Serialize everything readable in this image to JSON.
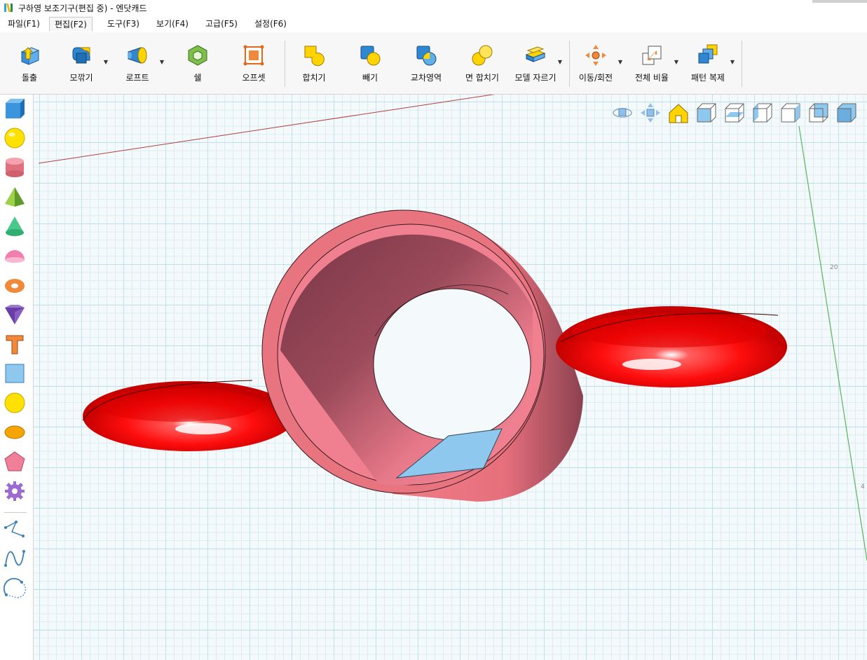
{
  "window": {
    "title": "구하영 보조기구(편집 중) - 엔닷캐드",
    "logo_icon": "ndotcad-logo-icon"
  },
  "menu": {
    "tabs": [
      {
        "label": "파일(F1)",
        "active": false
      },
      {
        "label": "편집(F2)",
        "active": true
      },
      {
        "label": "도구(F3)",
        "active": false
      },
      {
        "label": "보기(F4)",
        "active": false
      },
      {
        "label": "고급(F5)",
        "active": false
      },
      {
        "label": "설정(F6)",
        "active": false
      }
    ]
  },
  "ribbon": {
    "buttons": [
      {
        "label": "돌출",
        "icon": "extrude-icon",
        "has_dropdown": false
      },
      {
        "label": "모깎기",
        "icon": "fillet-icon",
        "has_dropdown": true
      },
      {
        "label": "로프트",
        "icon": "loft-icon",
        "has_dropdown": true
      },
      {
        "label": "쉘",
        "icon": "shell-icon",
        "has_dropdown": false
      },
      {
        "label": "오프셋",
        "icon": "offset-icon",
        "has_dropdown": false
      },
      {
        "label": "합치기",
        "icon": "union-icon",
        "has_dropdown": false
      },
      {
        "label": "빼기",
        "icon": "subtract-icon",
        "has_dropdown": false
      },
      {
        "label": "교차영역",
        "icon": "intersect-icon",
        "has_dropdown": false
      },
      {
        "label": "면 합치기",
        "icon": "face-merge-icon",
        "has_dropdown": false
      },
      {
        "label": "모델 자르기",
        "icon": "model-cut-icon",
        "has_dropdown": true
      },
      {
        "label": "이동/회전",
        "icon": "move-rotate-icon",
        "has_dropdown": true
      },
      {
        "label": "전체 비율",
        "icon": "scale-icon",
        "has_dropdown": true
      },
      {
        "label": "패턴 복제",
        "icon": "pattern-copy-icon",
        "has_dropdown": true
      }
    ]
  },
  "left_toolbar": {
    "tools": [
      {
        "name": "box-tool",
        "icon": "cube-icon"
      },
      {
        "name": "sphere-tool",
        "icon": "sphere-icon"
      },
      {
        "name": "cylinder-tool",
        "icon": "cylinder-icon"
      },
      {
        "name": "pyramid-tool",
        "icon": "pyramid-icon"
      },
      {
        "name": "cone-tool",
        "icon": "cone-icon"
      },
      {
        "name": "hemisphere-tool",
        "icon": "hemisphere-icon"
      },
      {
        "name": "torus-tool",
        "icon": "torus-icon"
      },
      {
        "name": "wedge-tool",
        "icon": "wedge-icon"
      },
      {
        "name": "text-tool",
        "icon": "text-t-icon"
      },
      {
        "name": "rectangle-tool",
        "icon": "rectangle-icon"
      },
      {
        "name": "circle-tool",
        "icon": "circle-icon"
      },
      {
        "name": "ellipse-tool",
        "icon": "ellipse-icon"
      },
      {
        "name": "polygon-tool",
        "icon": "pentagon-icon"
      },
      {
        "name": "gear-tool",
        "icon": "gear-icon"
      },
      {
        "name": "polyline-tool",
        "icon": "polyline-icon"
      },
      {
        "name": "spline-tool",
        "icon": "spline-icon"
      },
      {
        "name": "arc-tool",
        "icon": "arc-icon"
      }
    ]
  },
  "view_controls": [
    {
      "name": "orbit-view-button",
      "icon": "orbit-icon"
    },
    {
      "name": "pan-view-button",
      "icon": "pan-icon"
    },
    {
      "name": "home-view-button",
      "icon": "home-icon"
    },
    {
      "name": "front-view-button",
      "icon": "cube-front-icon"
    },
    {
      "name": "top-view-button",
      "icon": "cube-top-icon"
    },
    {
      "name": "left-view-button",
      "icon": "cube-left-icon"
    },
    {
      "name": "right-view-button",
      "icon": "cube-right-icon"
    },
    {
      "name": "back-view-button",
      "icon": "cube-back-icon"
    },
    {
      "name": "bottom-view-button",
      "icon": "cube-bottom-icon"
    }
  ],
  "viewport": {
    "axis_labels": [
      "20",
      "4"
    ],
    "colors": {
      "ring_outer": "#e8747f",
      "ring_inner": "#8a3f4d",
      "handle_red": "#ff1a1a",
      "blade_blue": "#8ec8ef",
      "grid_major": "#bfe0e8",
      "axis_green": "#5ab55a"
    }
  }
}
